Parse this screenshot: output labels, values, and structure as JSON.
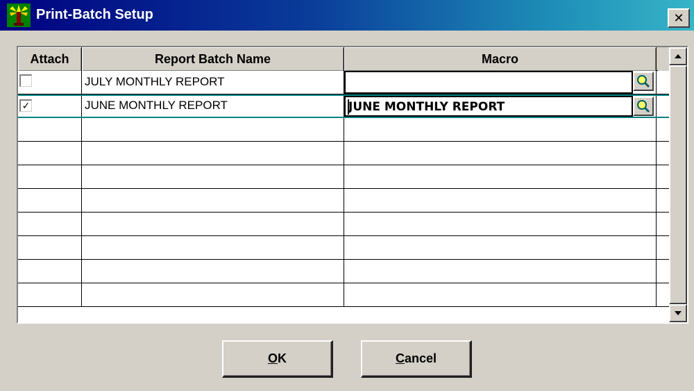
{
  "window": {
    "title": "Print-Batch Setup",
    "close_glyph": "✕",
    "app_icon": "tree-icon"
  },
  "table": {
    "columns": [
      "Attach",
      "Report Batch Name",
      "Macro"
    ],
    "rows": [
      {
        "attach": false,
        "name": "JULY MONTHLY REPORT",
        "macro": ""
      },
      {
        "attach": true,
        "name": "JUNE MONTHLY REPORT",
        "macro": "JUNE MONTHLY REPORT"
      }
    ],
    "empty_row_count": 8,
    "lookup_icon": "magnifier-icon"
  },
  "scrollbar": {
    "up_icon": "arrow-up-icon",
    "down_icon": "arrow-down-icon"
  },
  "buttons": {
    "ok": {
      "mnemonic": "O",
      "rest": "K"
    },
    "cancel": {
      "mnemonic": "C",
      "rest": "ancel"
    }
  },
  "colors": {
    "title_gradient_start": "#000080",
    "title_gradient_end": "#38b4c8",
    "face": "#d4d0c8",
    "selection_border": "#008080"
  }
}
